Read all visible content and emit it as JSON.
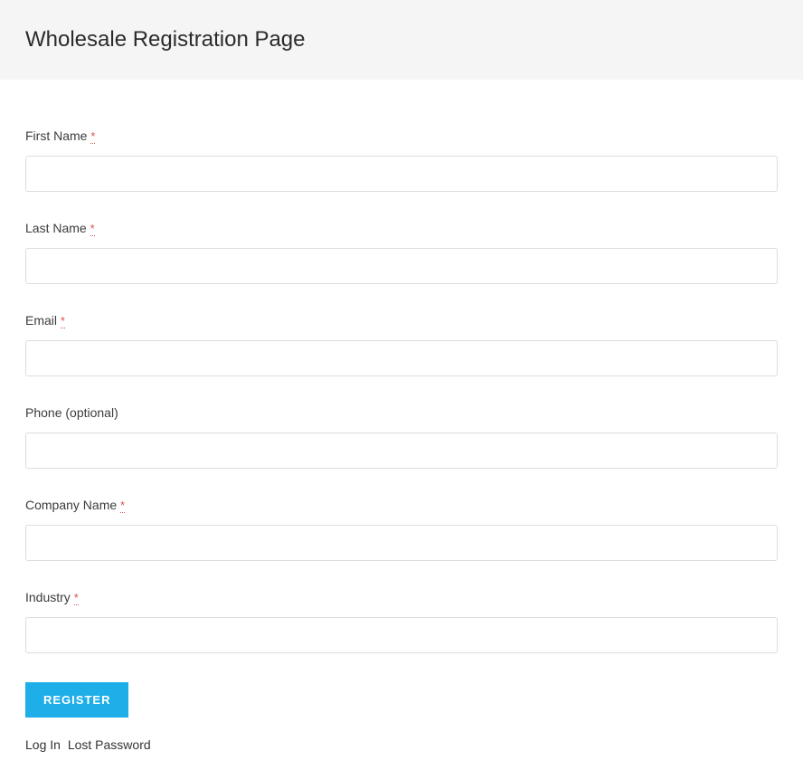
{
  "header": {
    "title": "Wholesale Registration Page"
  },
  "form": {
    "required_mark": "*",
    "fields": {
      "first_name": {
        "label": "First Name"
      },
      "last_name": {
        "label": "Last Name"
      },
      "email": {
        "label": "Email"
      },
      "phone": {
        "label": "Phone (optional)"
      },
      "company": {
        "label": "Company Name"
      },
      "industry": {
        "label": "Industry"
      }
    },
    "submit_label": "REGISTER"
  },
  "links": {
    "login": "Log In",
    "lost_password": "Lost Password"
  }
}
